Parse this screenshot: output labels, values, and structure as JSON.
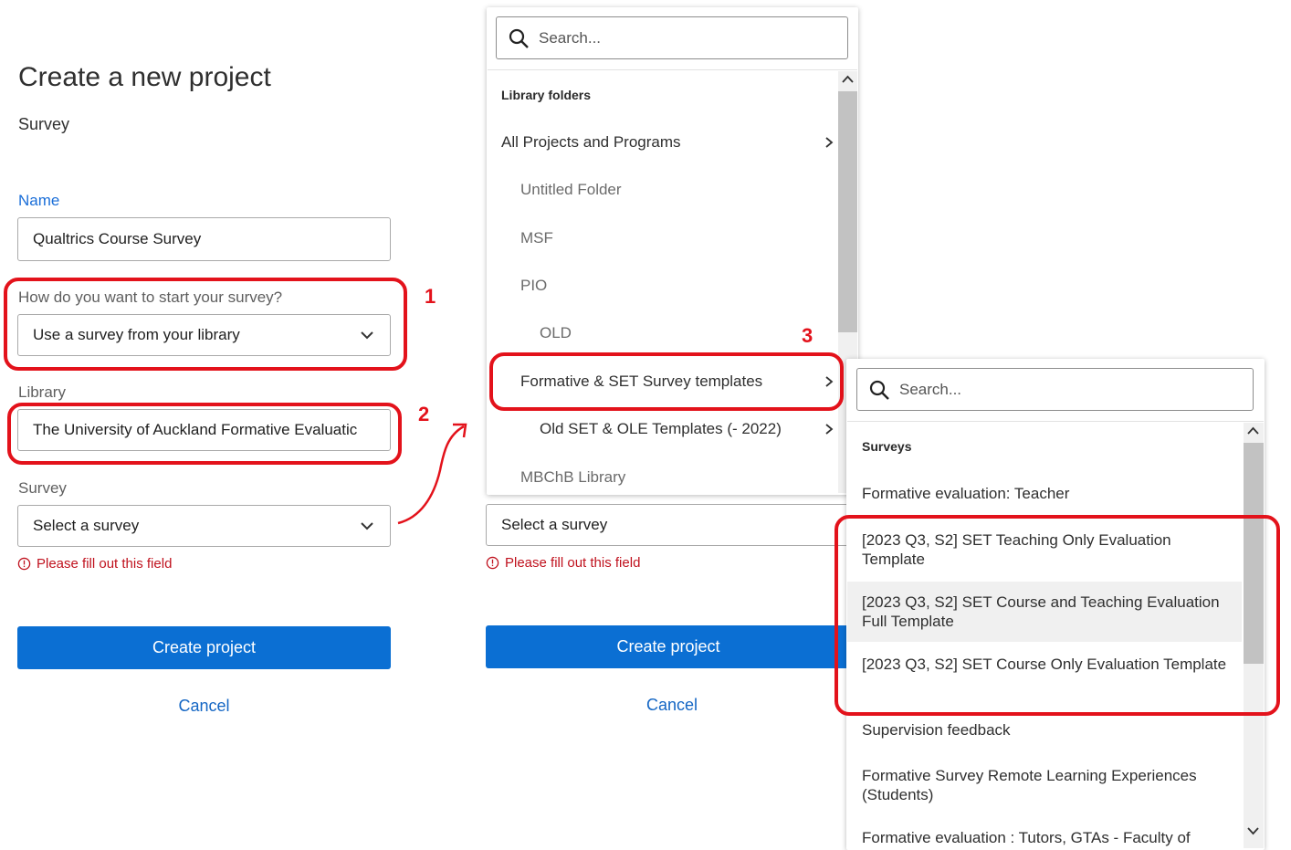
{
  "form": {
    "title": "Create a new project",
    "subtitle": "Survey",
    "name_label": "Name",
    "name_value": "Qualtrics Course Survey",
    "start_label": "How do you want to start your survey?",
    "start_value": "Use a survey from your library",
    "library_label": "Library",
    "library_value": "The University of Auckland Formative Evaluatic",
    "survey_label": "Survey",
    "survey_placeholder": "Select a survey",
    "error_text": "Please fill out this field",
    "create_label": "Create project",
    "cancel_label": "Cancel"
  },
  "form2": {
    "survey_placeholder": "Select a survey",
    "error_text": "Please fill out this field",
    "create_label": "Create project",
    "cancel_label": "Cancel"
  },
  "library_dropdown": {
    "search_placeholder": "Search...",
    "section": "Library folders",
    "items": [
      {
        "label": "All Projects and Programs"
      },
      {
        "label": "Untitled Folder"
      },
      {
        "label": "MSF"
      },
      {
        "label": "PIO"
      },
      {
        "label": "OLD"
      },
      {
        "label": "Formative & SET Survey templates"
      },
      {
        "label": "Old SET & OLE Templates (- 2022)"
      },
      {
        "label": "MBChB Library"
      }
    ]
  },
  "survey_dropdown": {
    "search_placeholder": "Search...",
    "section": "Surveys",
    "items": [
      {
        "label": "Formative evaluation: Teacher"
      },
      {
        "label": "[2023 Q3, S2] SET Teaching Only Evaluation Template"
      },
      {
        "label": "[2023 Q3, S2] SET Course and Teaching Evaluation Full Template"
      },
      {
        "label": "[2023 Q3, S2] SET Course Only Evaluation Template"
      },
      {
        "label": "Supervision feedback"
      },
      {
        "label": "Formative Survey Remote Learning Experiences (Students)"
      },
      {
        "label": "Formative evaluation : Tutors, GTAs - Faculty of"
      }
    ]
  },
  "annotations": {
    "step1": "1",
    "step2": "2",
    "step3": "3",
    "accent_color": "#e3121b"
  },
  "colors": {
    "primary_button": "#0b6fd3",
    "error": "#c0121e",
    "link": "#1466c4"
  }
}
